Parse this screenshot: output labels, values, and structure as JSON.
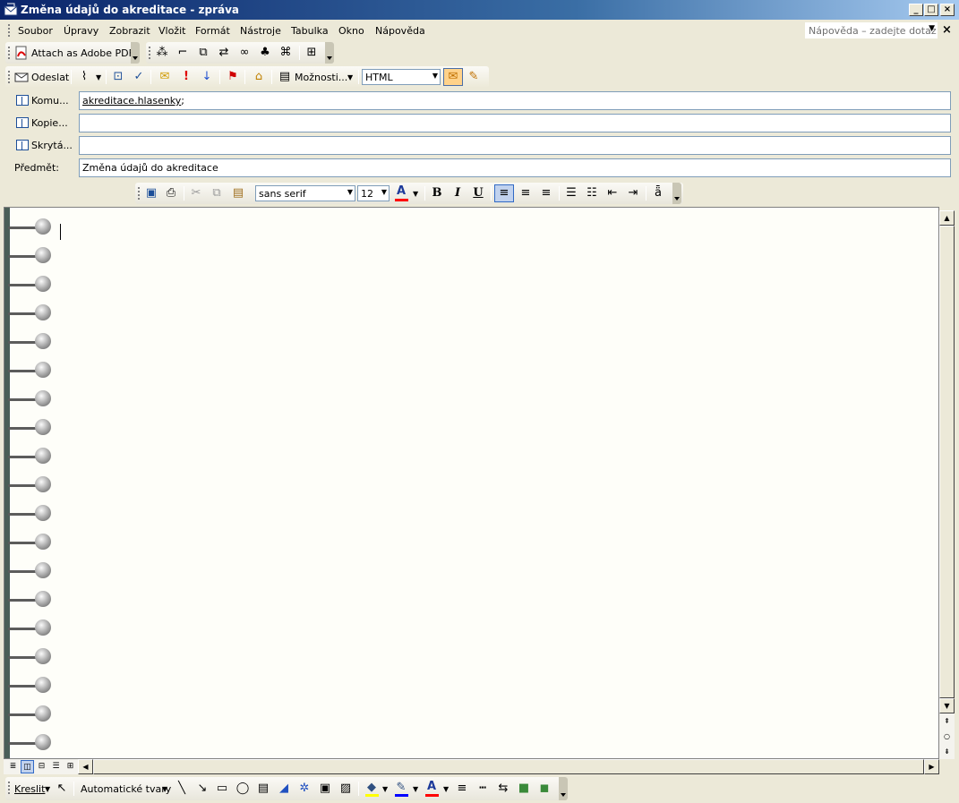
{
  "window": {
    "title": "Změna údajů do akreditace - zpráva",
    "minimize_glyph": "_",
    "maximize_glyph": "□",
    "close_glyph": "×"
  },
  "menu": {
    "items": [
      "Soubor",
      "Úpravy",
      "Zobrazit",
      "Vložit",
      "Formát",
      "Nástroje",
      "Tabulka",
      "Okno",
      "Nápověda"
    ],
    "help_placeholder": "Nápověda – zadejte dotaz",
    "doc_close_glyph": "×"
  },
  "toolbar_pdf": {
    "attach_label": "Attach as Adobe PDF"
  },
  "toolbar_send": {
    "send_label": "Odeslat",
    "options_label": "Možnosti...",
    "format_value": "HTML"
  },
  "address": {
    "to_label": "Komu...",
    "cc_label": "Kopie...",
    "bcc_label": "Skrytá...",
    "subject_label": "Předmět:",
    "to_value": "akreditace.hlasenky",
    "to_suffix": ";",
    "cc_value": "",
    "bcc_value": "",
    "subject_value": "Změna údajů do akreditace"
  },
  "format_toolbar": {
    "font": "sans serif",
    "size": "12",
    "bold": "B",
    "italic": "I",
    "underline": "U"
  },
  "drawing_toolbar": {
    "draw_label": "Kreslit",
    "autoshapes_label": "Automatické tvary"
  },
  "colors": {
    "title_start": "#0a246a",
    "chrome": "#ece9d8",
    "editor_bg": "#fefef9",
    "font_color_bar": "#ff0000",
    "highlight_bar": "#ffff00",
    "line_color_bar": "#0000ff"
  }
}
